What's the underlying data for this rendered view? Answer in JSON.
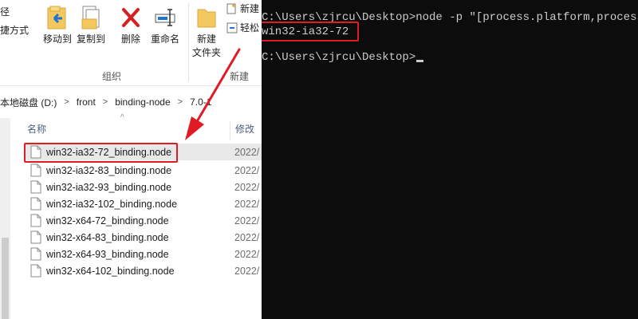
{
  "explorer": {
    "ribbon": {
      "partial_top_label": "径",
      "partial_left_label": "捷方式",
      "move_to": "移动到",
      "copy_to": "复制到",
      "delete": "删除",
      "rename": "重命名",
      "new_folder_line1": "新建",
      "new_folder_line2": "文件夹",
      "new_item": "新建",
      "easy_access": "轻松",
      "group_organize": "组织",
      "group_new": "新建"
    },
    "address": {
      "crumbs": [
        "本地磁盘 (D:)",
        "front",
        "binding-node",
        "7.0-1"
      ]
    },
    "list": {
      "col_name": "名称",
      "col_date": "修改日",
      "sort_glyph": "^",
      "files": [
        {
          "name": "win32-ia32-72_binding.node",
          "date": "2022/"
        },
        {
          "name": "win32-ia32-83_binding.node",
          "date": "2022/"
        },
        {
          "name": "win32-ia32-93_binding.node",
          "date": "2022/"
        },
        {
          "name": "win32-ia32-102_binding.node",
          "date": "2022/"
        },
        {
          "name": "win32-x64-72_binding.node",
          "date": "2022/"
        },
        {
          "name": "win32-x64-83_binding.node",
          "date": "2022/"
        },
        {
          "name": "win32-x64-93_binding.node",
          "date": "2022/"
        },
        {
          "name": "win32-x64-102_binding.node",
          "date": "2022/"
        }
      ],
      "selected_index": 0
    }
  },
  "terminal": {
    "line1": "C:\\Users\\zjrcu\\Desktop>node -p \"[process.platform,process.a",
    "line2": "win32-ia32-72",
    "line3": "C:\\Users\\zjrcu\\Desktop>"
  },
  "colors": {
    "highlight": "#e01b24",
    "terminal_bg": "#0c0c0c",
    "terminal_fg": "#cccccc"
  }
}
